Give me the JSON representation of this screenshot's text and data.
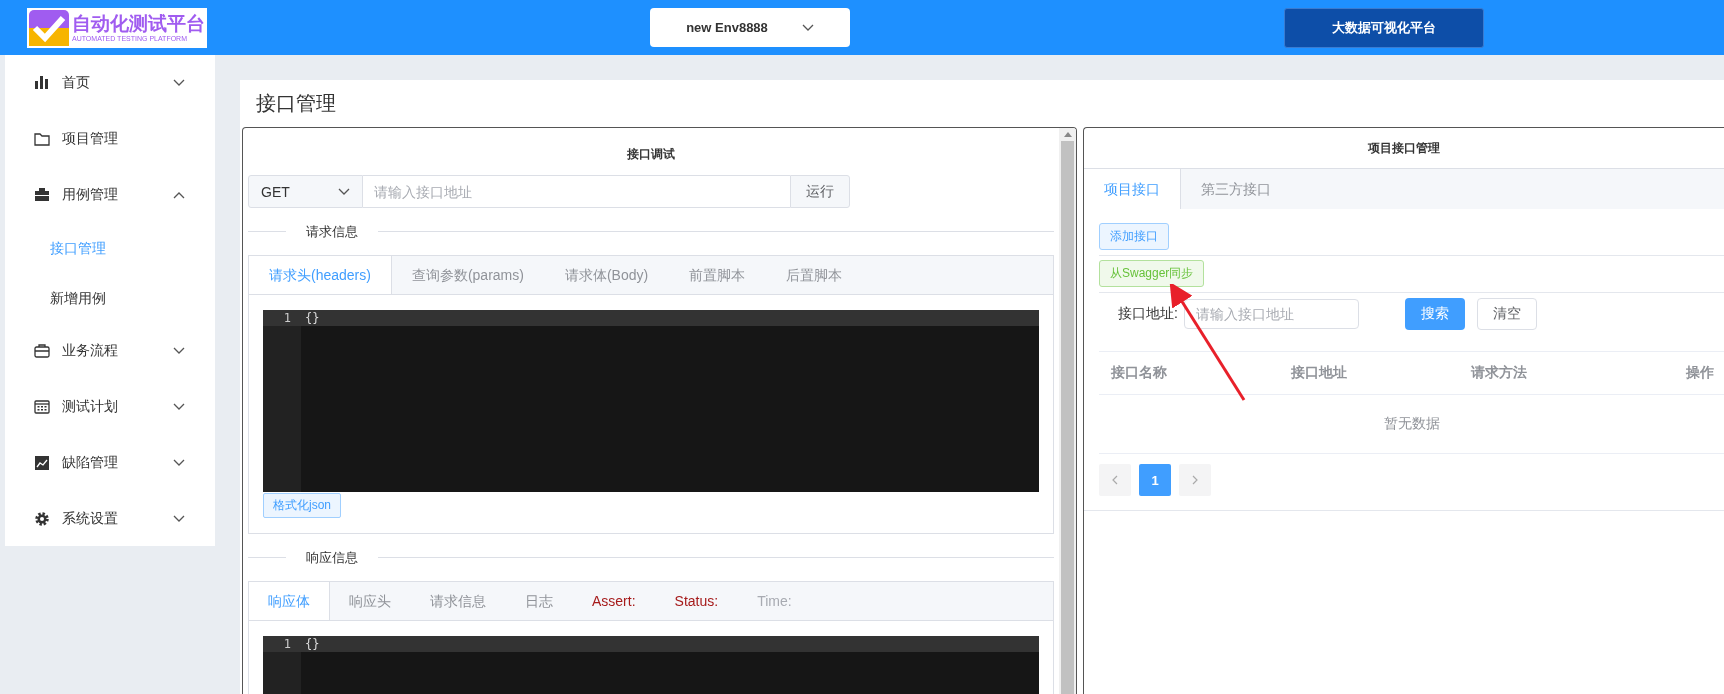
{
  "header": {
    "logo": {
      "title": "自动化测试平台",
      "subtitle": "AUTOMATED TESTING PLATFORM"
    },
    "env_select": {
      "value": "new Env8888"
    },
    "bigdata_button": "大数据可视化平台"
  },
  "sidebar": {
    "items": [
      {
        "label": "首页",
        "expanded": false
      },
      {
        "label": "项目管理"
      },
      {
        "label": "用例管理",
        "expanded": true,
        "children": [
          {
            "label": "接口管理",
            "selected": true
          },
          {
            "label": "新增用例",
            "selected": false
          }
        ]
      },
      {
        "label": "业务流程",
        "expanded": false
      },
      {
        "label": "测试计划",
        "expanded": false
      },
      {
        "label": "缺陷管理",
        "expanded": false
      },
      {
        "label": "系统设置",
        "expanded": false
      }
    ]
  },
  "page_title": "接口管理",
  "debug_panel": {
    "title": "接口调试",
    "method": "GET",
    "url_placeholder": "请输入接口地址",
    "run_button": "运行",
    "request_section": {
      "title": "请求信息",
      "tabs": [
        {
          "label": "请求头(headers)",
          "selected": true
        },
        {
          "label": "查询参数(params)",
          "selected": false
        },
        {
          "label": "请求体(Body)",
          "selected": false
        },
        {
          "label": "前置脚本",
          "selected": false
        },
        {
          "label": "后置脚本",
          "selected": false
        }
      ],
      "editor": {
        "lines": [
          {
            "number": "1",
            "text": "{}"
          }
        ]
      },
      "format_button": "格式化json"
    },
    "response_section": {
      "title": "响应信息",
      "tabs": [
        {
          "label": "响应体",
          "selected": true
        },
        {
          "label": "响应头",
          "selected": false
        },
        {
          "label": "请求信息",
          "selected": false
        },
        {
          "label": "日志",
          "selected": false
        },
        {
          "label": "Assert:",
          "selected": false,
          "color": "#a61b1b"
        },
        {
          "label": "Status:",
          "selected": false,
          "color": "#a61b1b"
        },
        {
          "label": "Time:",
          "selected": false,
          "color": "#a8abb2"
        }
      ],
      "editor": {
        "lines": [
          {
            "number": "1",
            "text": "{}"
          }
        ]
      }
    }
  },
  "project_panel": {
    "title": "项目接口管理",
    "tabs": [
      {
        "label": "项目接口",
        "selected": true
      },
      {
        "label": "第三方接口",
        "selected": false
      }
    ],
    "add_button": "添加接口",
    "swagger_button": "从Swagger同步",
    "search": {
      "label": "接口地址:",
      "placeholder": "请输入接口地址",
      "search_button": "搜索",
      "clear_button": "清空"
    },
    "table": {
      "columns": [
        "接口名称",
        "接口地址",
        "请求方法",
        "操作"
      ],
      "empty_text": "暂无数据"
    },
    "pagination": {
      "pages": [
        {
          "label": "1",
          "selected": true
        }
      ]
    }
  }
}
